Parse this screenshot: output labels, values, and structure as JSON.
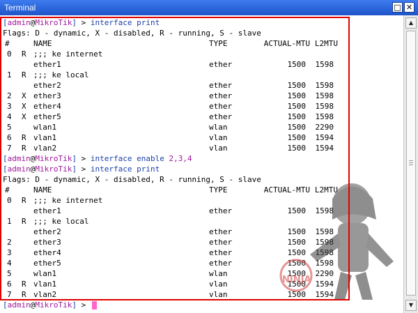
{
  "window": {
    "title": "Terminal",
    "maximize_glyph": "□",
    "close_glyph": "✕"
  },
  "prompt": {
    "user": "admin",
    "host": "MikroTik",
    "symbol": ">"
  },
  "commands": {
    "first": "interface print",
    "enable_cmd": "interface enable",
    "enable_args": "2,3,4",
    "second": "interface print"
  },
  "flags_line": "Flags: D - dynamic, X - disabled, R - running, S - slave",
  "columns": {
    "num": "#",
    "name": "NAME",
    "type": "TYPE",
    "mtu": "ACTUAL-MTU",
    "l2mtu": "L2MTU"
  },
  "table1": [
    {
      "kind": "comment",
      "num": "0",
      "flag": "R",
      "text": ";;; ke internet"
    },
    {
      "kind": "row",
      "num": "",
      "flag": "",
      "name": "ether1",
      "type": "ether",
      "mtu": "1500",
      "l2mtu": "1598"
    },
    {
      "kind": "comment",
      "num": "1",
      "flag": "R",
      "text": ";;; ke local"
    },
    {
      "kind": "row",
      "num": "",
      "flag": "",
      "name": "ether2",
      "type": "ether",
      "mtu": "1500",
      "l2mtu": "1598"
    },
    {
      "kind": "row",
      "num": "2",
      "flag": "X",
      "name": "ether3",
      "type": "ether",
      "mtu": "1500",
      "l2mtu": "1598"
    },
    {
      "kind": "row",
      "num": "3",
      "flag": "X",
      "name": "ether4",
      "type": "ether",
      "mtu": "1500",
      "l2mtu": "1598"
    },
    {
      "kind": "row",
      "num": "4",
      "flag": "X",
      "name": "ether5",
      "type": "ether",
      "mtu": "1500",
      "l2mtu": "1598"
    },
    {
      "kind": "row",
      "num": "5",
      "flag": "",
      "name": "wlan1",
      "type": "wlan",
      "mtu": "1500",
      "l2mtu": "2290"
    },
    {
      "kind": "row",
      "num": "6",
      "flag": "R",
      "name": "vlan1",
      "type": "vlan",
      "mtu": "1500",
      "l2mtu": "1594"
    },
    {
      "kind": "row",
      "num": "7",
      "flag": "R",
      "name": "vlan2",
      "type": "vlan",
      "mtu": "1500",
      "l2mtu": "1594"
    }
  ],
  "table2": [
    {
      "kind": "comment",
      "num": "0",
      "flag": "R",
      "text": ";;; ke internet"
    },
    {
      "kind": "row",
      "num": "",
      "flag": "",
      "name": "ether1",
      "type": "ether",
      "mtu": "1500",
      "l2mtu": "1598"
    },
    {
      "kind": "comment",
      "num": "1",
      "flag": "R",
      "text": ";;; ke local"
    },
    {
      "kind": "row",
      "num": "",
      "flag": "",
      "name": "ether2",
      "type": "ether",
      "mtu": "1500",
      "l2mtu": "1598"
    },
    {
      "kind": "row",
      "num": "2",
      "flag": "",
      "name": "ether3",
      "type": "ether",
      "mtu": "1500",
      "l2mtu": "1598"
    },
    {
      "kind": "row",
      "num": "3",
      "flag": "",
      "name": "ether4",
      "type": "ether",
      "mtu": "1500",
      "l2mtu": "1598"
    },
    {
      "kind": "row",
      "num": "4",
      "flag": "",
      "name": "ether5",
      "type": "ether",
      "mtu": "1500",
      "l2mtu": "1598"
    },
    {
      "kind": "row",
      "num": "5",
      "flag": "",
      "name": "wlan1",
      "type": "wlan",
      "mtu": "1500",
      "l2mtu": "2290"
    },
    {
      "kind": "row",
      "num": "6",
      "flag": "R",
      "name": "vlan1",
      "type": "vlan",
      "mtu": "1500",
      "l2mtu": "1594"
    },
    {
      "kind": "row",
      "num": "7",
      "flag": "R",
      "name": "vlan2",
      "type": "vlan",
      "mtu": "1500",
      "l2mtu": "1594"
    }
  ],
  "scrollbar": {
    "up_glyph": "▲",
    "down_glyph": "▼"
  },
  "watermark": {
    "icon": "anime-character-watermark-icon",
    "text": "NINJA"
  },
  "colors": {
    "highlight": "#e00000",
    "cursor": "#ff66cc",
    "titlebar": "#2a63d8"
  }
}
